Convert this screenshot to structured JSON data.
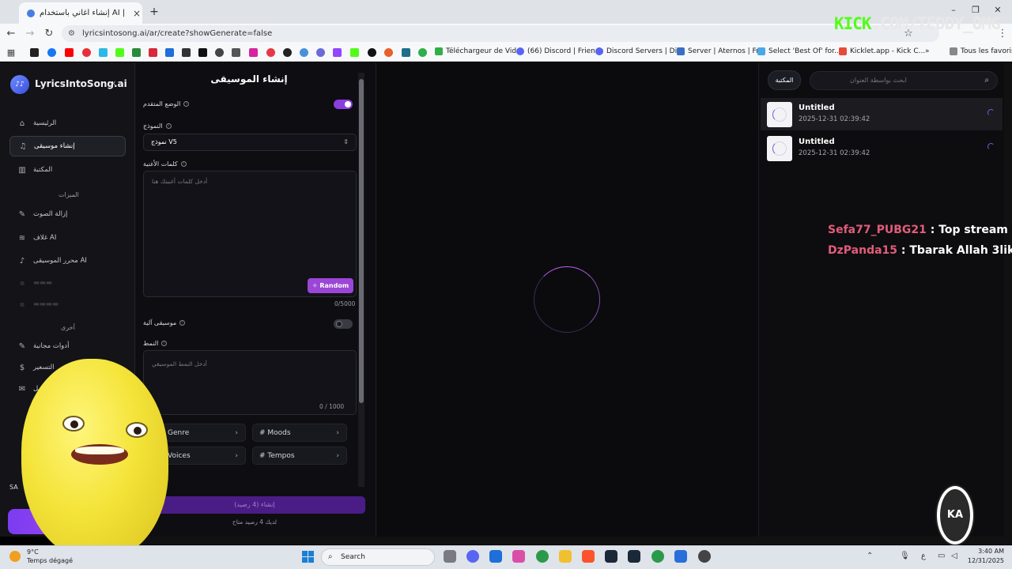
{
  "browser": {
    "tab_title": "إنشاء أغاني باستخدام AI | LyricsIntoSong",
    "tab_close": "×",
    "new_tab": "+",
    "url": "lyricsintosong.ai/ar/create?showGenerate=false",
    "bookmarks": [
      {
        "label": "Téléchargeur de Vid...",
        "color": "#2fae4a"
      },
      {
        "label": "(66) Discord | Friends",
        "color": "#5865f2"
      },
      {
        "label": "Discord Servers | Di...",
        "color": "#5865f2"
      },
      {
        "label": "Server | Aternos | Fr...",
        "color": "#3a6fc4"
      },
      {
        "label": "Select 'Best Of' for...",
        "color": "#4aa8e8"
      },
      {
        "label": "Kicklet.app - Kick C...",
        "color": "#e84a3a"
      }
    ],
    "all_bookmarks": "Tous les favoris"
  },
  "sidebar": {
    "logo_badge": "♪♪",
    "brand": "LyricsIntoSong.ai",
    "collapse": "‹",
    "items": [
      {
        "label": "الرئيسية",
        "icon": "⌂"
      },
      {
        "label": "إنشاء موسيقى",
        "icon": "♫"
      },
      {
        "label": "المكتبة",
        "icon": "▥"
      }
    ],
    "features_heading": "الميزات",
    "features": [
      {
        "label": "إزالة الصوت",
        "icon": "✎"
      },
      {
        "label": "غلاف AI",
        "icon": "≋"
      },
      {
        "label": "محرر الموسيقى AI",
        "icon": "♪"
      }
    ],
    "other_heading": "أخرى",
    "other": [
      {
        "label": "أدوات مجانية",
        "icon": "✎"
      },
      {
        "label": "التسعير",
        "icon": "$"
      },
      {
        "label": "تواصل",
        "icon": "✉"
      }
    ],
    "user_chip": "SA"
  },
  "form": {
    "title": "إنشاء الموسيقى",
    "advanced_label": "الوضع المتقدم",
    "advanced_on": true,
    "model_label": "النموذج",
    "model_value": "نموذج V5",
    "lyrics_label": "كلمات الأغنية",
    "lyrics_placeholder": "أدخل كلمات أغنيتك هنا",
    "random_button": "Random",
    "lyrics_counter": "0/5000",
    "instrumental_label": "موسيقى آلية",
    "instrumental_on": false,
    "style_label": "النمط",
    "style_placeholder": "أدخل النمط الموسيقي",
    "style_counter": "0 / 1000",
    "chips": [
      {
        "label": "Genre"
      },
      {
        "label": "# Moods"
      },
      {
        "label": "Voices"
      },
      {
        "label": "# Tempos"
      }
    ],
    "create_button": "إنشاء (4 رصيد)",
    "credits": "لديك 4 رصيد متاح"
  },
  "library": {
    "tab": "المكتبة",
    "search_placeholder": "ابحث بواسطة العنوان",
    "songs": [
      {
        "title": "Untitled",
        "date": "2025-12-31 02:39:42"
      },
      {
        "title": "Untitled",
        "date": "2025-12-31 02:39:42"
      }
    ]
  },
  "overlay": {
    "kick_brand": "KICK",
    "kick_rest": ".COM/TEDDY_OMG",
    "chat": [
      {
        "user": "Sefa77_PUBG21",
        "msg": " : Top stream"
      },
      {
        "user": "DzPanda15",
        "msg": " : Tbarak Allah 3lik"
      }
    ],
    "emblem_text": "KA"
  },
  "taskbar": {
    "weather_temp": "9°C",
    "weather_desc": "Temps dégagé",
    "search": "Search",
    "time": "3:40 AM",
    "date": "12/31/2025",
    "ime": "ع"
  },
  "colors": {
    "accent": "#7b3cf0",
    "random_button": "#9b46d6",
    "kick_green": "#53fc18",
    "chat_user": "#e25c7a"
  }
}
